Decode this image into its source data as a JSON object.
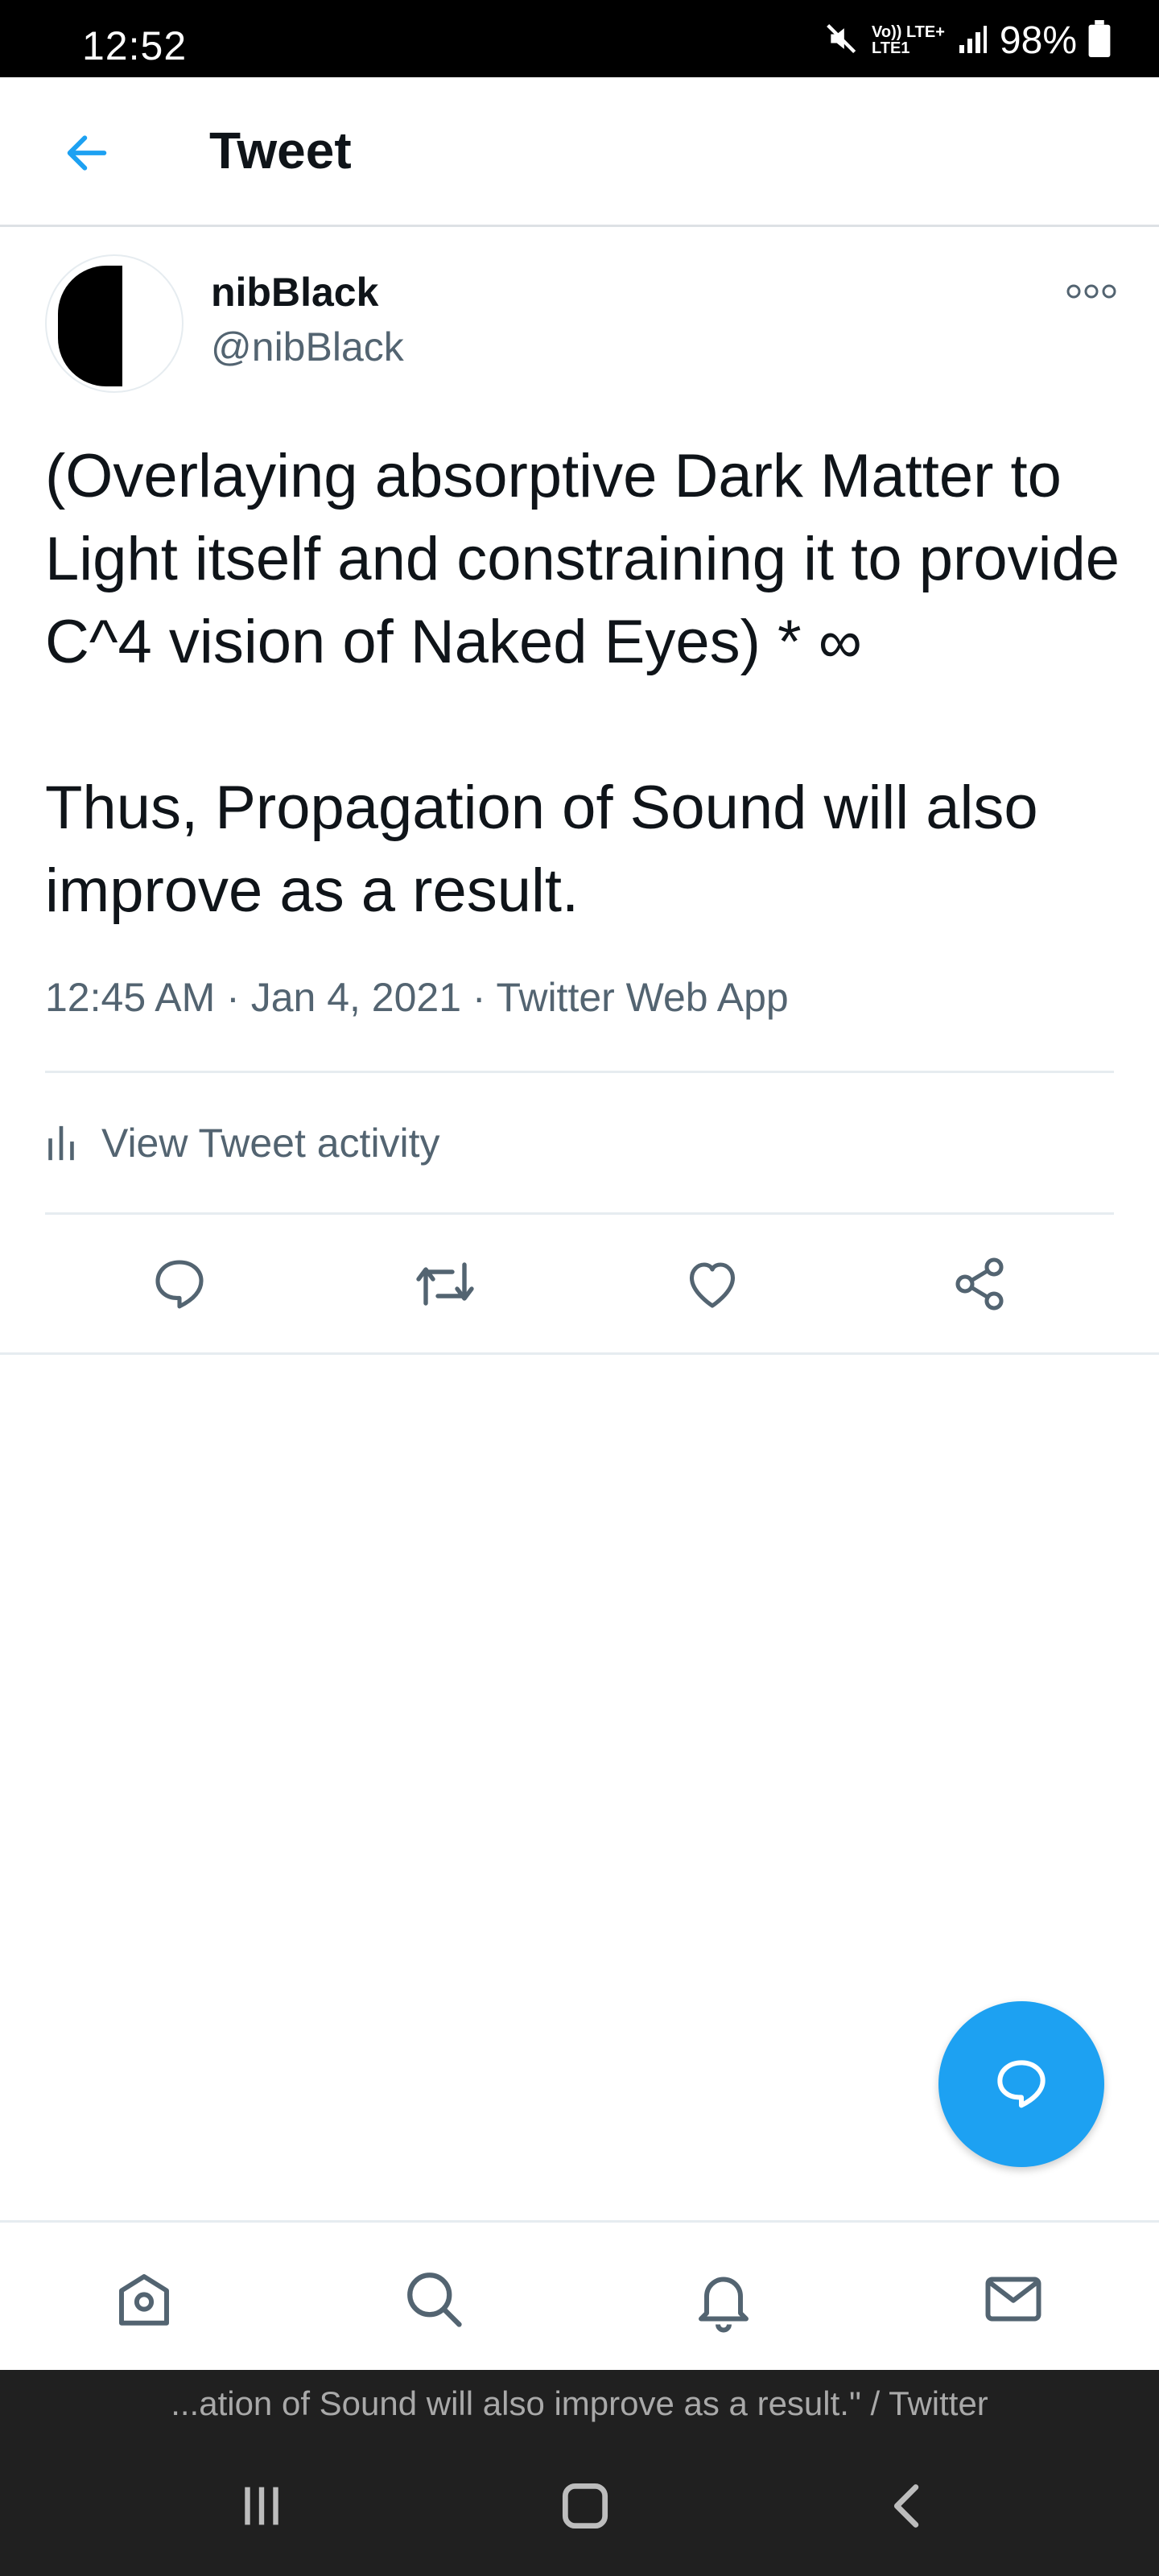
{
  "status_bar": {
    "time": "12:52",
    "network_line1": "Vo)) LTE+",
    "network_line2": "LTE1",
    "battery": "98%",
    "icons": [
      "mute-icon",
      "signal-icon",
      "battery-icon"
    ]
  },
  "header": {
    "title": "Tweet",
    "back_icon": "arrow-left-icon"
  },
  "tweet": {
    "author_name": "nibBlack",
    "author_handle": "@nibBlack",
    "text": "(Overlaying absorptive Dark Matter to Light itself and constraining it to provide C^4 vision of Naked Eyes) * ∞\n\nThus, Propagation of Sound will also improve as a result.",
    "meta": "12:45 AM · Jan 4, 2021 · Twitter Web App",
    "activity_label": "View Tweet activity"
  },
  "actions": [
    "reply-icon",
    "retweet-icon",
    "like-icon",
    "share-icon"
  ],
  "bottom_nav": [
    "home-icon",
    "search-icon",
    "notifications-icon",
    "messages-icon"
  ],
  "caption": "...ation of Sound will also improve as a result.\" / Twitter",
  "colors": {
    "accent": "#1da1f2",
    "text": "#0f1419",
    "secondary": "#536471",
    "divider": "#e6ecf0"
  }
}
